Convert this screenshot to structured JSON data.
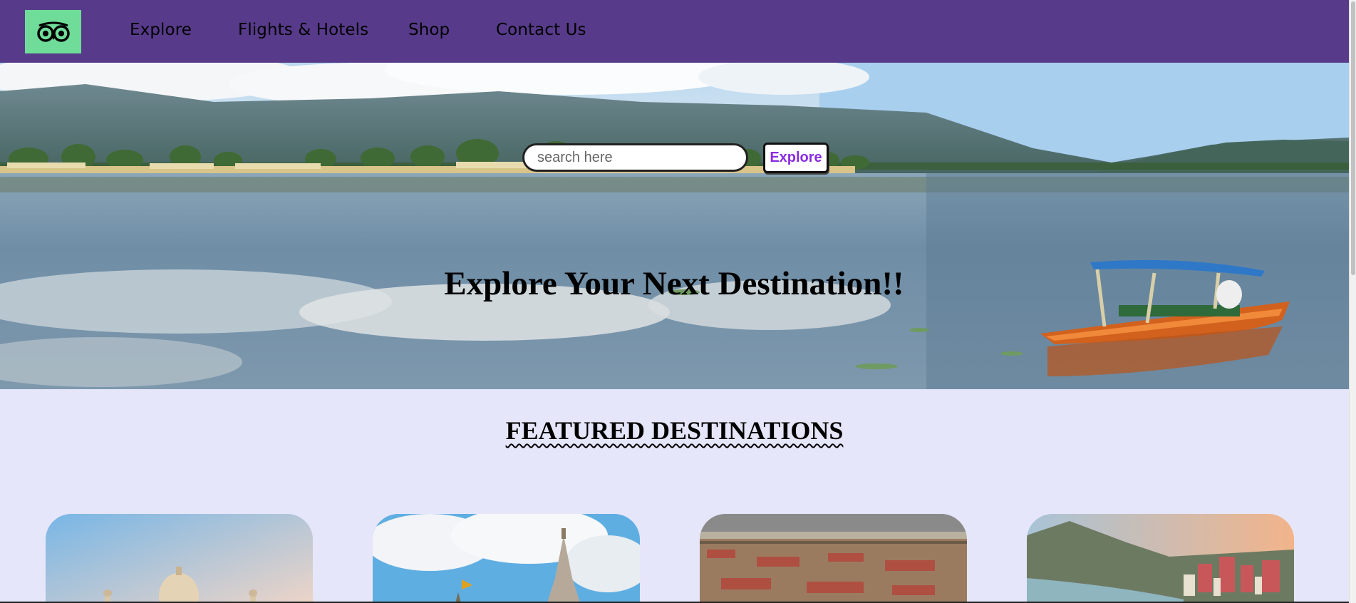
{
  "nav": {
    "logo_icon": "owl-eyes-logo-icon",
    "links": [
      "Explore",
      "Flights & Hotels",
      "Shop",
      "Contact Us"
    ]
  },
  "hero": {
    "search_placeholder": "search here",
    "search_button": "Explore",
    "title": "Explore Your Next Destination!!"
  },
  "featured": {
    "title": "FEATURED DESTINATIONS",
    "cards": [
      {
        "image": "taj-mahal"
      },
      {
        "image": "temple-spire"
      },
      {
        "image": "festival-crowd"
      },
      {
        "image": "riverside-town"
      }
    ]
  },
  "colors": {
    "navbar": "#573b8a",
    "logo_bg": "#6fdc99",
    "page_bg": "#e6e6fa",
    "button_text": "#8a2be2"
  }
}
